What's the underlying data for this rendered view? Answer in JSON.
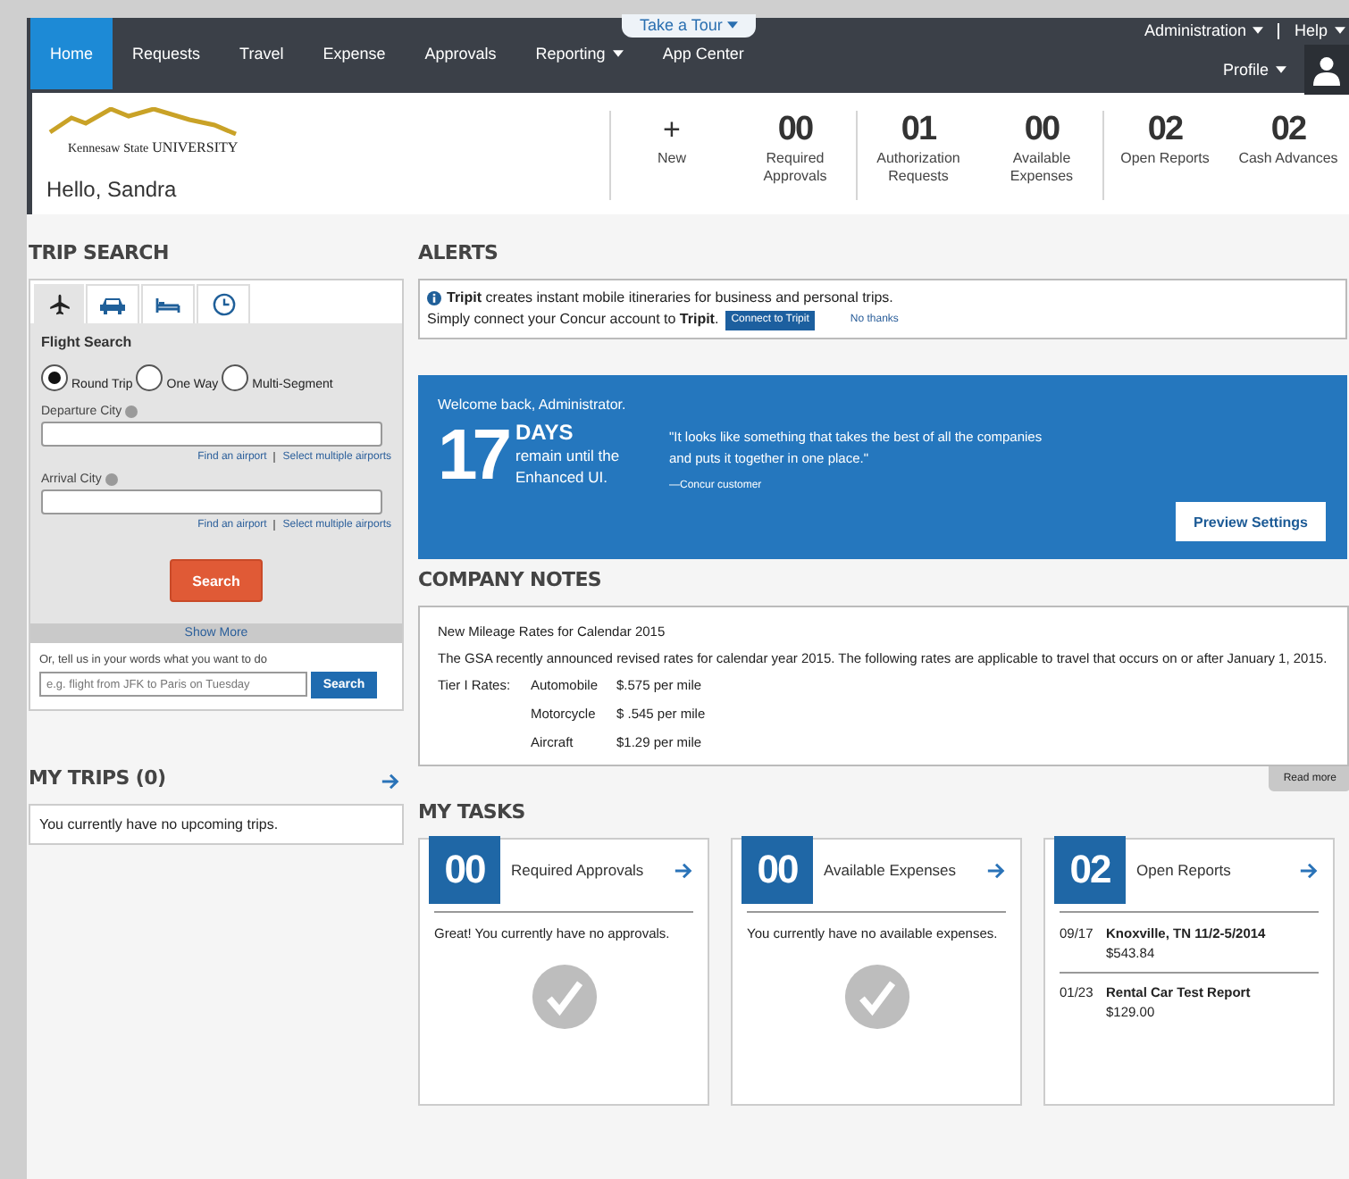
{
  "nav": {
    "items": [
      {
        "label": "Home",
        "selected": true,
        "has_menu": false
      },
      {
        "label": "Requests",
        "selected": false,
        "has_menu": false
      },
      {
        "label": "Travel",
        "selected": false,
        "has_menu": false
      },
      {
        "label": "Expense",
        "selected": false,
        "has_menu": false
      },
      {
        "label": "Approvals",
        "selected": false,
        "has_menu": false
      },
      {
        "label": "Reporting",
        "selected": false,
        "has_menu": true
      },
      {
        "label": "App Center",
        "selected": false,
        "has_menu": false
      }
    ],
    "tour": "Take a Tour",
    "admin": "Administration",
    "help": "Help",
    "profile": "Profile"
  },
  "header": {
    "logo": [
      "Kennesaw",
      "State",
      "UNIVERSITY"
    ],
    "greeting": "Hello, Sandra",
    "stats": [
      {
        "kind": "action",
        "value": "+",
        "label": "New",
        "divider_before": true
      },
      {
        "kind": "count",
        "value": "00",
        "label": "Required Approvals",
        "divider_before": false
      },
      {
        "kind": "count",
        "value": "01",
        "label": "Authorization Requests",
        "divider_before": true
      },
      {
        "kind": "count",
        "value": "00",
        "label": "Available Expenses",
        "divider_before": false
      },
      {
        "kind": "count",
        "value": "02",
        "label": "Open Reports",
        "divider_before": true
      },
      {
        "kind": "count",
        "value": "02",
        "label": "Cash Advances",
        "divider_before": false
      }
    ]
  },
  "trip_search": {
    "title": "TRIP SEARCH",
    "tabs": [
      {
        "kind": "plane",
        "selected": true
      },
      {
        "kind": "car",
        "selected": false
      },
      {
        "kind": "hotel",
        "selected": false
      },
      {
        "kind": "clock",
        "selected": false
      }
    ],
    "form_title": "Flight Search",
    "trip_types": [
      {
        "label": "Round Trip",
        "selected": true
      },
      {
        "label": "One Way",
        "selected": false
      },
      {
        "label": "Multi-Segment",
        "selected": false
      }
    ],
    "fields": [
      {
        "label": "Departure City",
        "links": [
          "Find an airport",
          "Select multiple airports"
        ]
      },
      {
        "label": "Arrival City",
        "links": [
          "Find an airport",
          "Select multiple airports"
        ]
      }
    ],
    "search_button": "Search",
    "show_more": "Show More",
    "natural_prompt": "Or, tell us in your words what you want to do",
    "natural_placeholder": "e.g. flight from JFK to Paris on Tuesday",
    "natural_button": "Search"
  },
  "my_trips": {
    "title": "MY TRIPS (0)",
    "message": "You currently have no upcoming trips."
  },
  "alerts": {
    "title": "ALERTS",
    "lines": [
      "**Tripit** creates instant mobile itineraries for business and personal trips.",
      "Simply connect your Concur account to **Tripit**."
    ],
    "connect_button": "Connect to Tripit",
    "dismiss_link": "No thanks"
  },
  "banner": {
    "welcome": "Welcome back, Administrator.",
    "days": "17",
    "days_unit": "DAYS",
    "remain": "remain until the Enhanced UI.",
    "quote": "\"It looks like something that takes the best of all the companies and puts it together in one place.\"",
    "source": "—Concur customer",
    "button": "Preview Settings"
  },
  "company_notes": {
    "title": "COMPANY NOTES",
    "heading": "New Mileage Rates for Calendar 2015",
    "paragraph": "The GSA recently announced revised rates for calendar year 2015.  The following rates are applicable to travel that occurs on or after January 1, 2015.",
    "rates": [
      {
        "label": "Tier I Rates:",
        "vehicle": "Automobile",
        "rate": "$.575 per mile"
      },
      {
        "vehicle": "Motorcycle",
        "rate": "$ .545 per mile"
      },
      {
        "vehicle": "Aircraft",
        "rate": "$1.29 per mile"
      }
    ],
    "read_more": "Read more"
  },
  "my_tasks": {
    "title": "MY TASKS",
    "cards": [
      {
        "count": "00",
        "title": "Required Approvals",
        "kind": "empty",
        "message": "Great!  You currently have no approvals."
      },
      {
        "count": "00",
        "title": "Available Expenses",
        "kind": "empty",
        "message": "You currently have no available expenses."
      },
      {
        "count": "02",
        "title": "Open Reports",
        "kind": "list",
        "items": [
          {
            "date": "09/17",
            "name": "Knoxville, TN 11/2-5/2014",
            "amount": "$543.84"
          },
          {
            "date": "01/23",
            "name": "Rental Car Test Report",
            "amount": "$129.00"
          }
        ]
      }
    ]
  }
}
